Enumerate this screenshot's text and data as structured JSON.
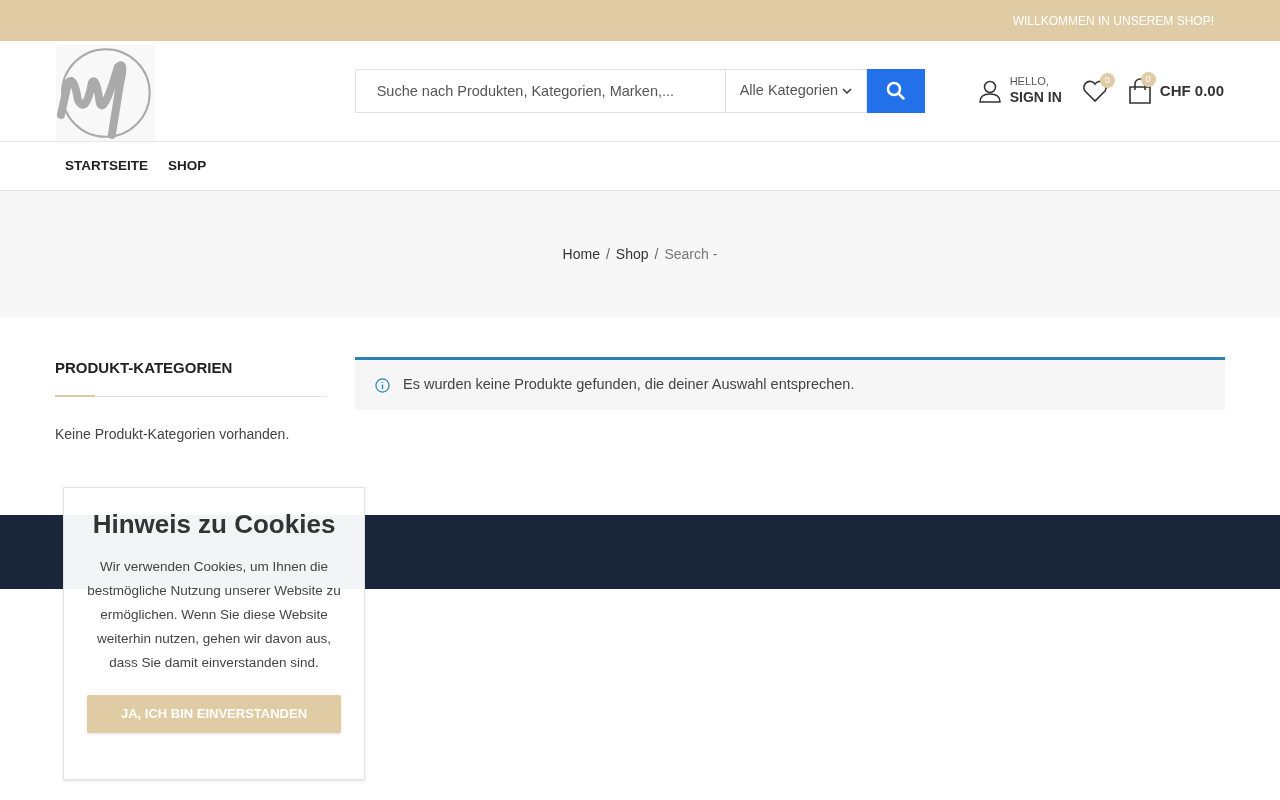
{
  "top_bar": {
    "text": "WILLKOMMEN IN UNSEREM SHOP!"
  },
  "header": {
    "search": {
      "placeholder": "Suche nach Produkten, Kategorien, Marken,...",
      "category": "Alle Kategorien"
    },
    "account": {
      "greeting": "HELLO,",
      "action": "SIGN IN"
    },
    "wishlist": {
      "count": "0"
    },
    "cart": {
      "count": "0",
      "total": "CHF 0.00"
    }
  },
  "nav": [
    {
      "label": "STARTSEITE"
    },
    {
      "label": "SHOP"
    }
  ],
  "breadcrumb": {
    "separator": "/",
    "items": [
      {
        "label": "Home",
        "link": true
      },
      {
        "label": "Shop",
        "link": true
      },
      {
        "label": "Search -",
        "link": false
      }
    ]
  },
  "sidebar": {
    "title": "PRODUKT-KATEGORIEN",
    "text": "Keine Produkt-Kategorien vorhanden."
  },
  "notice": {
    "text": "Es wurden keine Produkte gefunden, die deiner Auswahl entsprechen."
  },
  "cookie_popup": {
    "title": "Hinweis zu Cookies",
    "text": "Wir verwenden Cookies, um Ihnen die bestmögliche Nutzung unserer Website zu ermöglichen. Wenn Sie diese Website weiterhin nutzen, gehen wir davon aus, dass Sie damit einverstanden sind.",
    "button": "JA, ICH BIN EINVERSTANDEN"
  }
}
